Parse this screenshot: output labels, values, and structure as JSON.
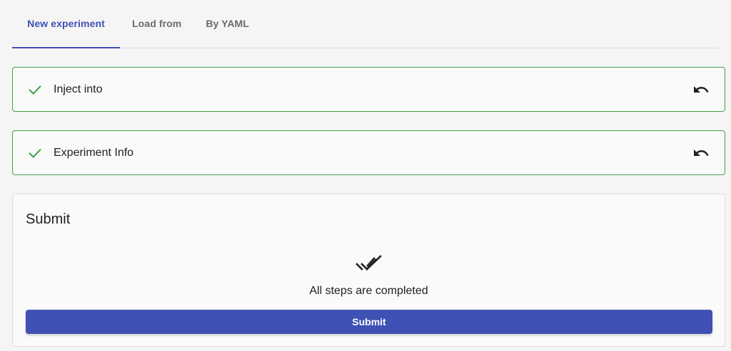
{
  "tabs": [
    {
      "label": "New experiment",
      "active": true
    },
    {
      "label": "Load from",
      "active": false
    },
    {
      "label": "By YAML",
      "active": false
    }
  ],
  "steps": [
    {
      "label": "Inject into",
      "status_icon": "check-icon",
      "action_icon": "undo-icon"
    },
    {
      "label": "Experiment Info",
      "status_icon": "check-icon",
      "action_icon": "undo-icon"
    }
  ],
  "submit": {
    "title": "Submit",
    "status_icon": "done-all-icon",
    "status_text": "All steps are completed",
    "button_label": "Submit"
  },
  "colors": {
    "accent": "#3f51b5",
    "success": "#43a047",
    "background": "#f5f5f5",
    "panel": "#fafafa"
  }
}
